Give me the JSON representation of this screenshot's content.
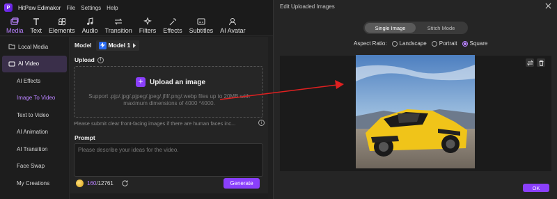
{
  "app": {
    "name": "HitPaw Edimakor",
    "menus": [
      "File",
      "Settings",
      "Help"
    ]
  },
  "toolbar": [
    {
      "label": "Media",
      "icon": "media-icon",
      "active": true
    },
    {
      "label": "Text",
      "icon": "text-icon"
    },
    {
      "label": "Elements",
      "icon": "elements-icon"
    },
    {
      "label": "Audio",
      "icon": "audio-icon"
    },
    {
      "label": "Transition",
      "icon": "transition-icon"
    },
    {
      "label": "Filters",
      "icon": "filters-icon"
    },
    {
      "label": "Effects",
      "icon": "effects-icon"
    },
    {
      "label": "Subtitles",
      "icon": "subtitles-icon"
    },
    {
      "label": "AI Avatar",
      "icon": "ai-avatar-icon"
    }
  ],
  "sidebar": {
    "items": [
      {
        "label": "Local Media"
      },
      {
        "label": "AI Video"
      },
      {
        "label": "AI Effects"
      },
      {
        "label": "Image To Video"
      },
      {
        "label": "Text to Video"
      },
      {
        "label": "AI Animation"
      },
      {
        "label": "AI Transition"
      },
      {
        "label": "Face Swap"
      },
      {
        "label": "My Creations"
      }
    ]
  },
  "panel": {
    "model_label": "Model",
    "model_value": "Model 1",
    "upload_label": "Upload",
    "upload_button": "Upload an image",
    "upload_hint": "Support .pjp/.jpg/.pjpeg/.jpeg/.jfif/.png/.webp files up to 20MB with maximum dimensions of 4000 *4000.",
    "face_note": "Please submit clear front-facing images if there are human faces inc...",
    "prompt_label": "Prompt",
    "prompt_placeholder": "Please describe your ideas for the video.",
    "credits_used": "160",
    "credits_total": "/12761",
    "generate_label": "Generate"
  },
  "dialog": {
    "title": "Edit Uploaded Images",
    "modes": [
      "Single Image",
      "Stitch Mode"
    ],
    "active_mode": "Single Image",
    "aspect_label": "Aspect Ratio:",
    "aspect_options": [
      "Landscape",
      "Portrait",
      "Square"
    ],
    "aspect_selected": "Square",
    "ok_label": "OK"
  },
  "colors": {
    "accent": "#8a3ffc",
    "accent_text": "#b982ff",
    "annotation": "#e02020"
  }
}
